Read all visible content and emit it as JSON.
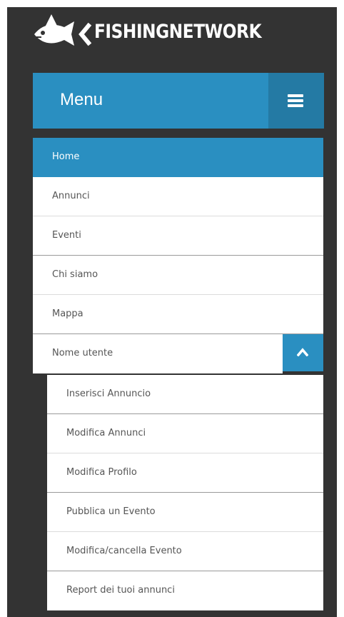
{
  "header": {
    "brand": "FISHINGNETWORK",
    "logo_icon": "fish-logo-icon"
  },
  "menu": {
    "title": "Menu",
    "toggle_icon": "hamburger-icon"
  },
  "nav": {
    "items": [
      {
        "label": "Home",
        "active": true
      },
      {
        "label": "Annunci"
      },
      {
        "label": "Eventi"
      },
      {
        "label": "Chi siamo"
      },
      {
        "label": "Mappa"
      }
    ],
    "user": {
      "label": "Nome utente",
      "toggle_icon": "chevron-up-icon"
    },
    "submenu": [
      {
        "label": "Inserisci Annuncio"
      },
      {
        "label": "Modifica Annunci"
      },
      {
        "label": "Modifica Profilo"
      },
      {
        "label": "Pubblica un Evento"
      },
      {
        "label": "Modifica/cancella Evento"
      },
      {
        "label": "Report dei tuoi annunci"
      }
    ]
  },
  "colors": {
    "accent": "#2a8fc1",
    "accent_dark": "#247aa4",
    "background": "#333333"
  }
}
